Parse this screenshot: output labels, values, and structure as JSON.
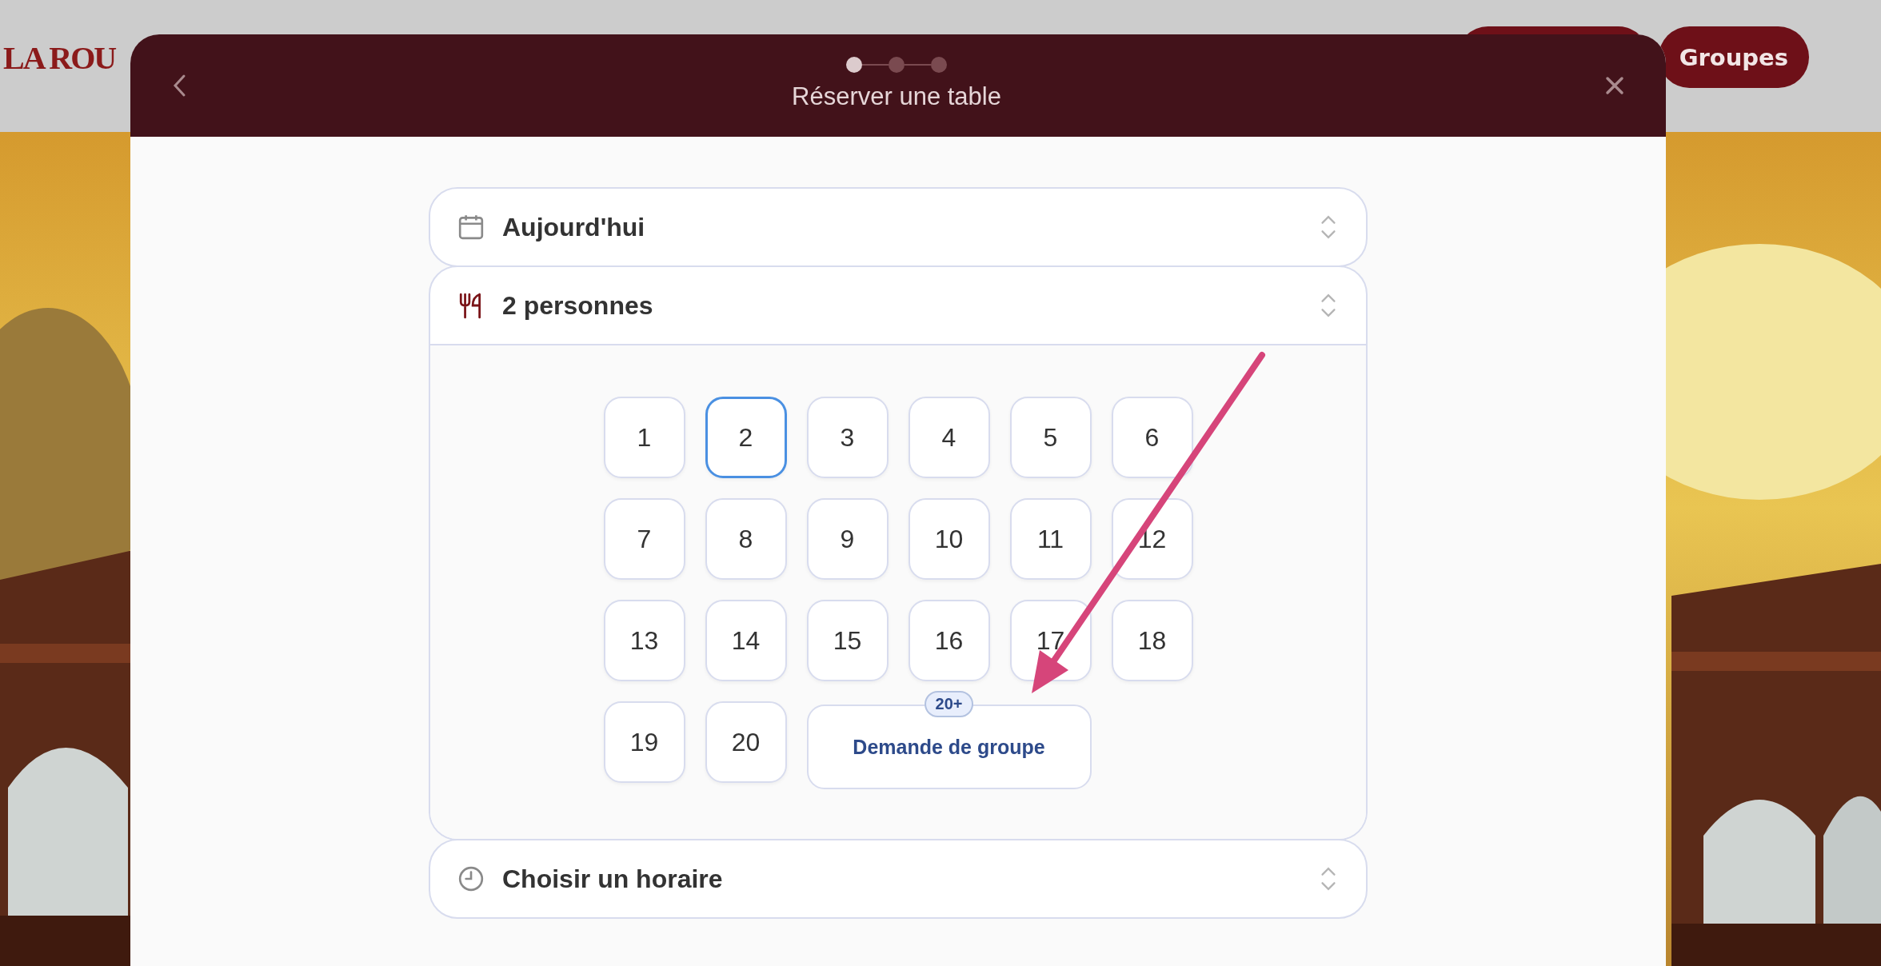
{
  "site": {
    "logo": "LA ROU",
    "nav_button": "Groupes"
  },
  "modal": {
    "title": "Réserver une table",
    "steps": [
      {
        "selected": true
      },
      {
        "selected": false
      },
      {
        "selected": false
      }
    ],
    "fields": [
      {
        "kind": "date",
        "label": "Aujourd'hui",
        "expanded": false
      },
      {
        "kind": "guests",
        "label": "2 personnes",
        "expanded": true
      },
      {
        "kind": "time",
        "label": "Choisir un horaire",
        "expanded": false
      }
    ],
    "party_sizes": [
      {
        "label": "1",
        "selected": false
      },
      {
        "label": "2",
        "selected": true
      },
      {
        "label": "3",
        "selected": false
      },
      {
        "label": "4",
        "selected": false
      },
      {
        "label": "5",
        "selected": false
      },
      {
        "label": "6",
        "selected": false
      },
      {
        "label": "7",
        "selected": false
      },
      {
        "label": "8",
        "selected": false
      },
      {
        "label": "9",
        "selected": false
      },
      {
        "label": "10",
        "selected": false
      },
      {
        "label": "11",
        "selected": false
      },
      {
        "label": "12",
        "selected": false
      },
      {
        "label": "13",
        "selected": false
      },
      {
        "label": "14",
        "selected": false
      },
      {
        "label": "15",
        "selected": false
      },
      {
        "label": "16",
        "selected": false
      },
      {
        "label": "17",
        "selected": false
      },
      {
        "label": "18",
        "selected": false
      },
      {
        "label": "19",
        "selected": false
      },
      {
        "label": "20",
        "selected": false
      }
    ],
    "group_request": {
      "badge": "20+",
      "label": "Demande de groupe"
    }
  }
}
